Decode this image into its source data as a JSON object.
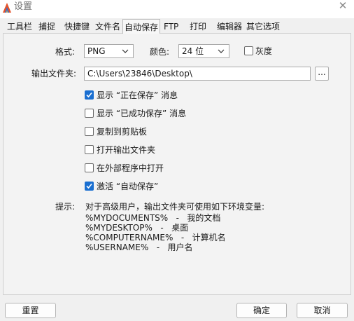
{
  "window": {
    "title": "设置"
  },
  "tabs": [
    {
      "label": "工具栏"
    },
    {
      "label": "捕捉"
    },
    {
      "label": "快捷键"
    },
    {
      "label": "文件名"
    },
    {
      "label": "自动保存",
      "active": true
    },
    {
      "label": "FTP"
    },
    {
      "label": "打印"
    },
    {
      "label": "编辑器"
    },
    {
      "label": "其它选项"
    }
  ],
  "format": {
    "label": "格式:",
    "value": "PNG"
  },
  "color": {
    "label": "颜色:",
    "value": "24 位"
  },
  "grayscale": {
    "label": "灰度",
    "checked": false
  },
  "output_folder": {
    "label": "输出文件夹:",
    "value": "C:\\Users\\23846\\Desktop\\",
    "browse_label": "..."
  },
  "options": [
    {
      "label": "显示 “正在保存” 消息",
      "checked": true
    },
    {
      "label": "显示 “已成功保存” 消息",
      "checked": false
    },
    {
      "label": "复制到剪贴板",
      "checked": false
    },
    {
      "label": "打开输出文件夹",
      "checked": false
    },
    {
      "label": "在外部程序中打开",
      "checked": false
    },
    {
      "label": "激活 “自动保存”",
      "checked": true
    }
  ],
  "hint": {
    "label": "提示:",
    "intro": "对于高级用户，输出文件夹可使用如下环境变量:",
    "vars": [
      "%MYDOCUMENTS%   -   我的文档",
      "%MYDESKTOP%   -   桌面",
      "%COMPUTERNAME%   -   计算机名",
      "%USERNAME%   -   用户名"
    ]
  },
  "buttons": {
    "reset": "重置",
    "ok": "确定",
    "cancel": "取消"
  },
  "colors": {
    "accent": "#1a6fd1",
    "window_bg": "#f0f0f0",
    "panel_bg": "#f3f3f3"
  }
}
